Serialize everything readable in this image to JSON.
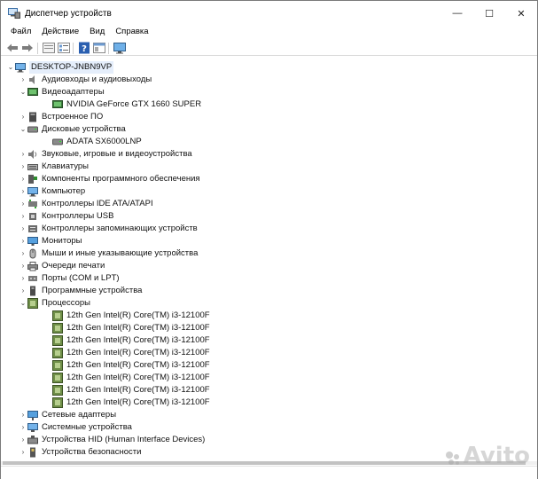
{
  "window": {
    "title": "Диспетчер устройств",
    "minimize_glyph": "—",
    "maximize_glyph": "☐",
    "close_glyph": "✕"
  },
  "menu": {
    "items": [
      "Файл",
      "Действие",
      "Вид",
      "Справка"
    ]
  },
  "toolbar": {
    "icons": [
      "back-arrow-icon",
      "forward-arrow-icon",
      "properties-icon",
      "list-icon",
      "help-icon",
      "view-icon",
      "monitor-scan-icon"
    ]
  },
  "tree": {
    "root": "DESKTOP-JNBN9VP",
    "categories": [
      {
        "label": "Аудиовходы и аудиовыходы",
        "icon": "audio-icon",
        "expanded": false
      },
      {
        "label": "Видеоадаптеры",
        "icon": "display-adapter-icon",
        "expanded": true,
        "children": [
          "NVIDIA GeForce GTX 1660 SUPER"
        ]
      },
      {
        "label": "Встроенное ПО",
        "icon": "firmware-icon",
        "expanded": false
      },
      {
        "label": "Дисковые устройства",
        "icon": "disk-icon",
        "expanded": true,
        "children": [
          "ADATA SX6000LNP"
        ]
      },
      {
        "label": "Звуковые, игровые и видеоустройства",
        "icon": "sound-icon",
        "expanded": false
      },
      {
        "label": "Клавиатуры",
        "icon": "keyboard-icon",
        "expanded": false
      },
      {
        "label": "Компоненты программного обеспечения",
        "icon": "software-component-icon",
        "expanded": false
      },
      {
        "label": "Компьютер",
        "icon": "computer-icon",
        "expanded": false
      },
      {
        "label": "Контроллеры IDE ATA/ATAPI",
        "icon": "ide-controller-icon",
        "expanded": false
      },
      {
        "label": "Контроллеры USB",
        "icon": "usb-icon",
        "expanded": false
      },
      {
        "label": "Контроллеры запоминающих устройств",
        "icon": "storage-controller-icon",
        "expanded": false
      },
      {
        "label": "Мониторы",
        "icon": "monitor-icon",
        "expanded": false
      },
      {
        "label": "Мыши и иные указывающие устройства",
        "icon": "mouse-icon",
        "expanded": false
      },
      {
        "label": "Очереди печати",
        "icon": "printer-icon",
        "expanded": false
      },
      {
        "label": "Порты (COM и LPT)",
        "icon": "port-icon",
        "expanded": false
      },
      {
        "label": "Программные устройства",
        "icon": "software-device-icon",
        "expanded": false
      },
      {
        "label": "Процессоры",
        "icon": "processor-icon",
        "expanded": true,
        "children": [
          "12th Gen Intel(R) Core(TM) i3-12100F",
          "12th Gen Intel(R) Core(TM) i3-12100F",
          "12th Gen Intel(R) Core(TM) i3-12100F",
          "12th Gen Intel(R) Core(TM) i3-12100F",
          "12th Gen Intel(R) Core(TM) i3-12100F",
          "12th Gen Intel(R) Core(TM) i3-12100F",
          "12th Gen Intel(R) Core(TM) i3-12100F",
          "12th Gen Intel(R) Core(TM) i3-12100F"
        ]
      },
      {
        "label": "Сетевые адаптеры",
        "icon": "network-adapter-icon",
        "expanded": false
      },
      {
        "label": "Системные устройства",
        "icon": "system-device-icon",
        "expanded": false
      },
      {
        "label": "Устройства HID (Human Interface Devices)",
        "icon": "hid-icon",
        "expanded": false
      },
      {
        "label": "Устройства безопасности",
        "icon": "security-device-icon",
        "expanded": false
      }
    ]
  },
  "watermark": "Avito",
  "colors": {
    "selection": "#e5eefb",
    "icon_blue": "#2b79c9",
    "cpu_green": "#5c7a3a"
  }
}
